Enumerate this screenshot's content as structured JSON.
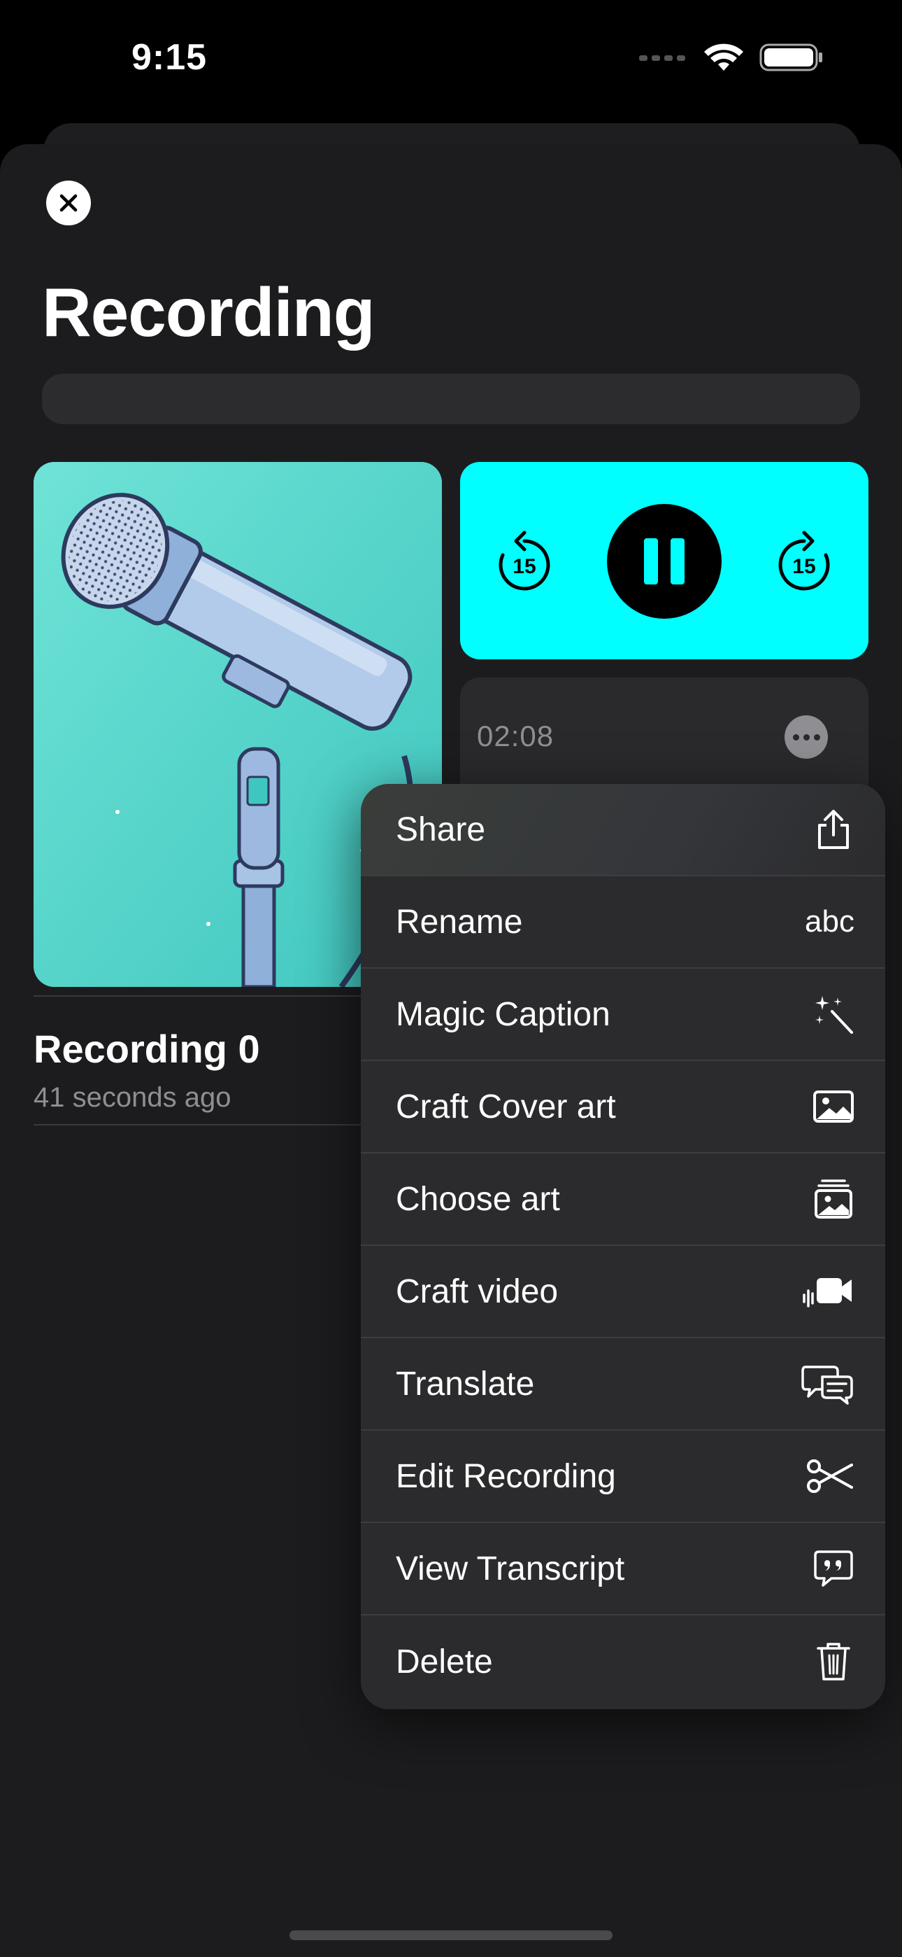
{
  "status_bar": {
    "time": "9:15"
  },
  "sheet": {
    "title": "Recording"
  },
  "player": {
    "skip_back_seconds": "15",
    "skip_forward_seconds": "15",
    "duration": "02:08",
    "accent_color": "#00ffff"
  },
  "recording": {
    "name": "Recording 0",
    "time_ago": "41 seconds ago"
  },
  "menu": {
    "items": [
      {
        "label": "Share",
        "icon": "share-icon"
      },
      {
        "label": "Rename",
        "icon": "abc",
        "icon_text": "abc"
      },
      {
        "label": "Magic Caption",
        "icon": "sparkles-wand-icon"
      },
      {
        "label": "Craft Cover art",
        "icon": "photo-icon"
      },
      {
        "label": "Choose art",
        "icon": "photo-stack-icon"
      },
      {
        "label": "Craft video",
        "icon": "video-icon"
      },
      {
        "label": "Translate",
        "icon": "chat-bubbles-icon"
      },
      {
        "label": "Edit Recording",
        "icon": "scissors-icon"
      },
      {
        "label": "View Transcript",
        "icon": "quote-bubble-icon"
      },
      {
        "label": "Delete",
        "icon": "trash-icon"
      }
    ]
  }
}
